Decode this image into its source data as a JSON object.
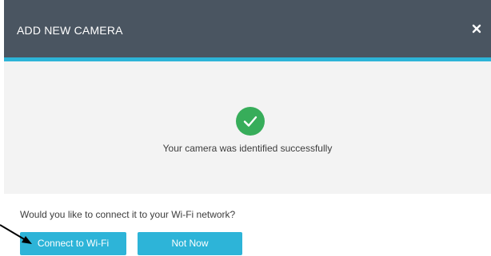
{
  "modal": {
    "title": "ADD NEW CAMERA",
    "close_icon": "close-icon",
    "success_icon": "checkmark-circle-icon",
    "success_message": "Your camera was identified successfully",
    "question": "Would you like to connect it to your Wi-Fi network?",
    "buttons": {
      "connect_label": "Connect to Wi-Fi",
      "not_now_label": "Not Now"
    }
  },
  "colors": {
    "header_bg": "#4a5561",
    "accent": "#2db4d8",
    "success": "#37ad5a",
    "panel_bg": "#f3f3f3"
  }
}
